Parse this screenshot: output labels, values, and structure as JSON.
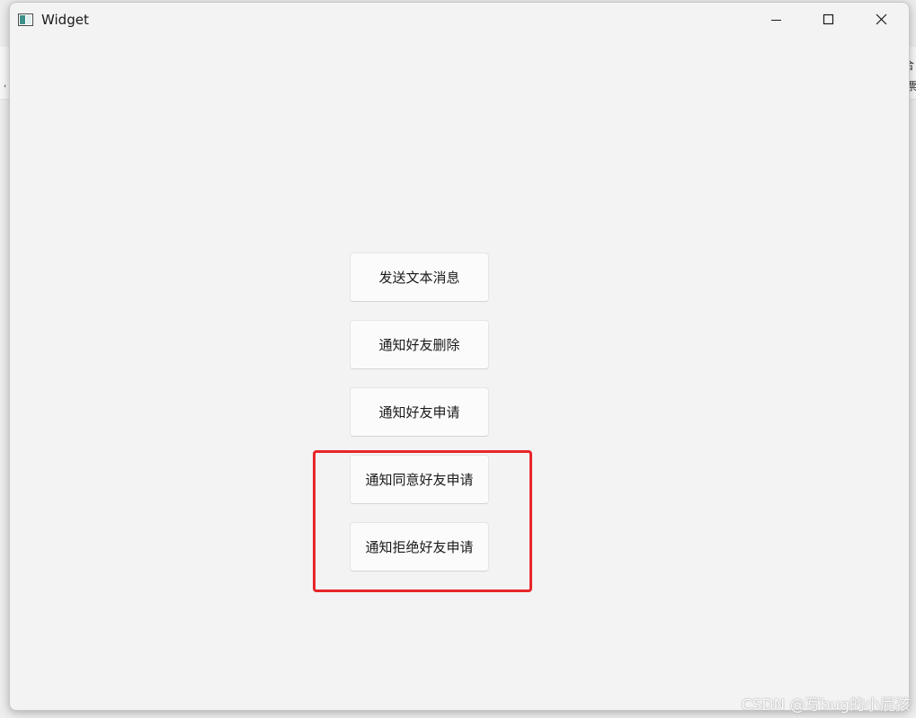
{
  "window": {
    "title": "Widget",
    "controls": {
      "minimize": "minimize-icon",
      "maximize": "maximize-icon",
      "close": "close-icon"
    }
  },
  "buttons": [
    {
      "label": "发送文本消息"
    },
    {
      "label": "通知好友删除"
    },
    {
      "label": "通知好友申请"
    },
    {
      "label": "通知同意好友申请"
    },
    {
      "label": "通知拒绝好友申请"
    }
  ],
  "highlight_color": "#e8262a",
  "watermark": "CSDN @写bug的小屁孩"
}
